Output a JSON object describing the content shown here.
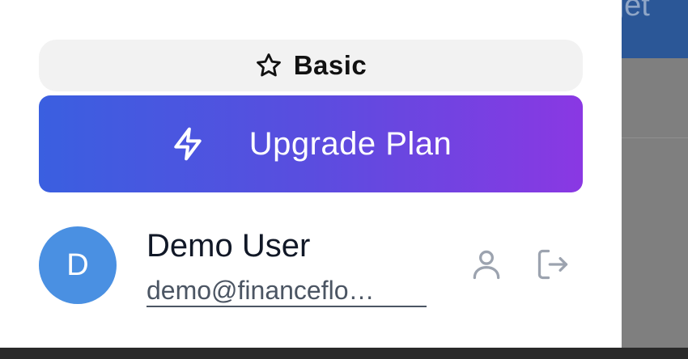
{
  "background": {
    "header_text": "get"
  },
  "plan": {
    "icon": "star-icon",
    "label": "Basic"
  },
  "upgrade": {
    "icon": "lightning-bolt-icon",
    "label": "Upgrade Plan",
    "gradient_start": "#3a5fe0",
    "gradient_end": "#8a38e3"
  },
  "user": {
    "avatar_initial": "D",
    "avatar_color": "#4a90e2",
    "name": "Demo User",
    "email": "demo@financeflo…"
  },
  "actions": {
    "profile_icon": "user-icon",
    "logout_icon": "logout-icon"
  }
}
